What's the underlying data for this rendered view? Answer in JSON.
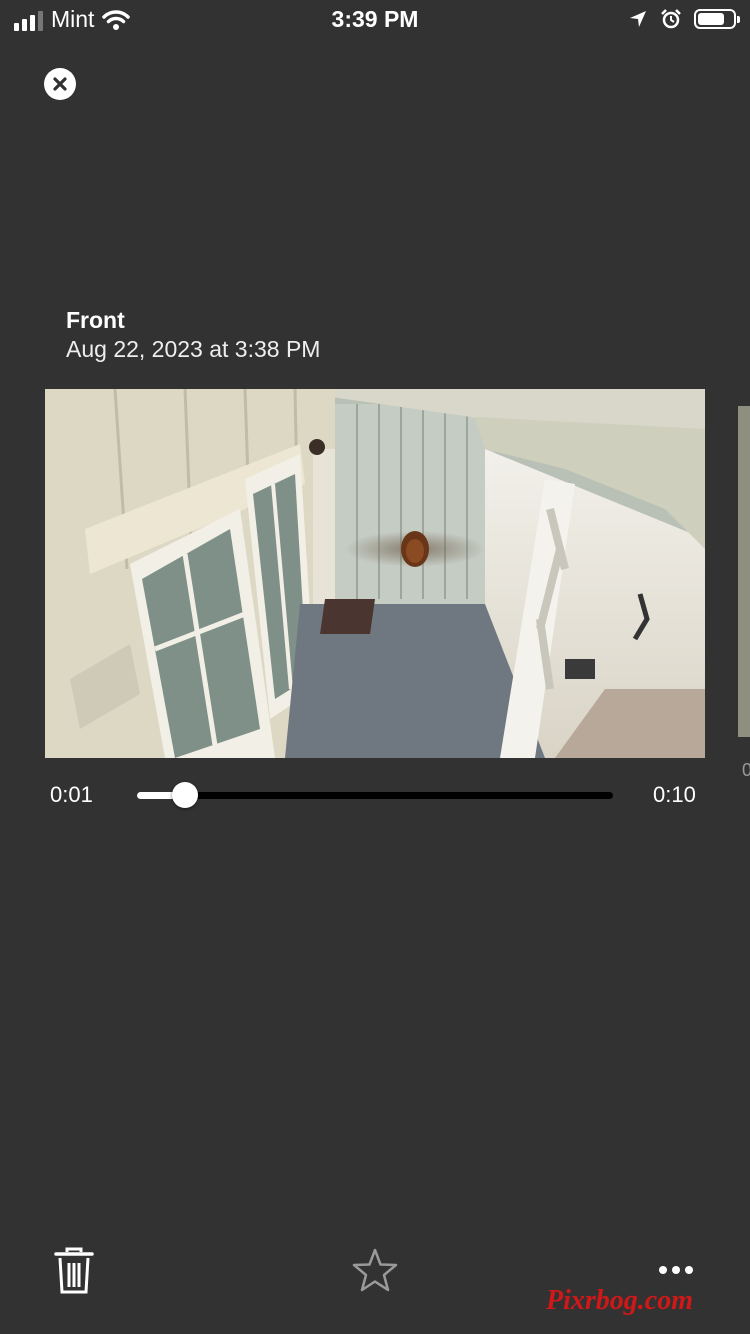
{
  "status_bar": {
    "carrier": "Mint",
    "time": "3:39 PM",
    "battery_level": 0.8
  },
  "clip": {
    "camera_name": "Front",
    "timestamp": "Aug 22, 2023 at 3:38 PM"
  },
  "player": {
    "current_time": "0:01",
    "duration": "0:10",
    "progress": 0.1
  },
  "next_clip": {
    "partial_text": "0"
  },
  "toolbar": {
    "delete_icon": "trash-icon",
    "favorite_icon": "star-icon",
    "more_icon": "more-icon"
  },
  "watermark": "Pixrbog.com",
  "colors": {
    "background": "#323232",
    "text": "#ffffff",
    "accent": "#ffffff",
    "track": "#000000"
  }
}
